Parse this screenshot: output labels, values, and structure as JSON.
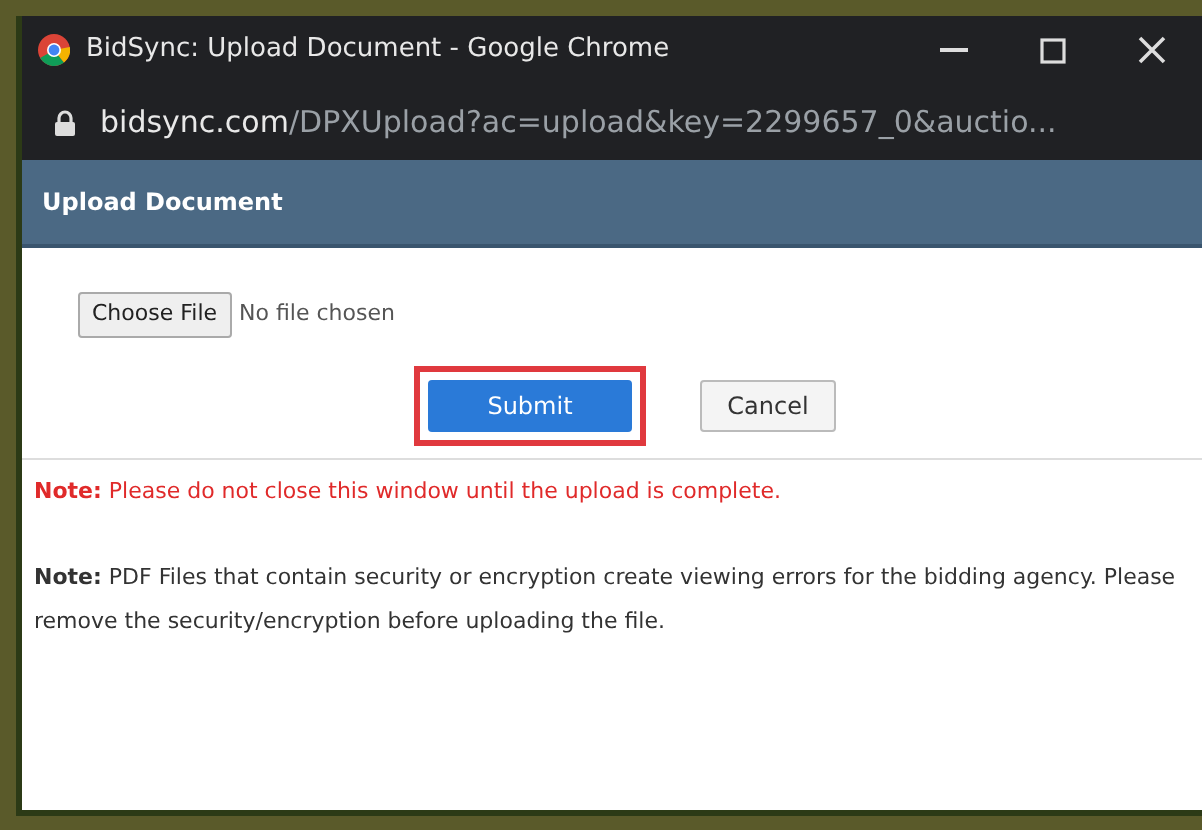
{
  "window": {
    "title": "BidSync: Upload Document - Google Chrome"
  },
  "address_bar": {
    "domain": "bidsync.com",
    "path": "/DPXUpload?ac=upload&key=2299657_0&auctio..."
  },
  "header": {
    "title": "Upload Document"
  },
  "file_input": {
    "button": "Choose File",
    "status": "No file chosen"
  },
  "buttons": [
    {
      "label": "Submit",
      "kind": "primary",
      "highlighted": true
    },
    {
      "label": "Cancel",
      "kind": "secondary",
      "highlighted": false
    }
  ],
  "notes": [
    {
      "text": "**Note:** Please do not close this window until the upload is complete.",
      "kind": "warning"
    },
    {
      "text": "**Note:** PDF Files that contain security or encryption create viewing errors for the bidding agency. Please remove the security/encryption before uploading the file.",
      "kind": "info"
    }
  ]
}
